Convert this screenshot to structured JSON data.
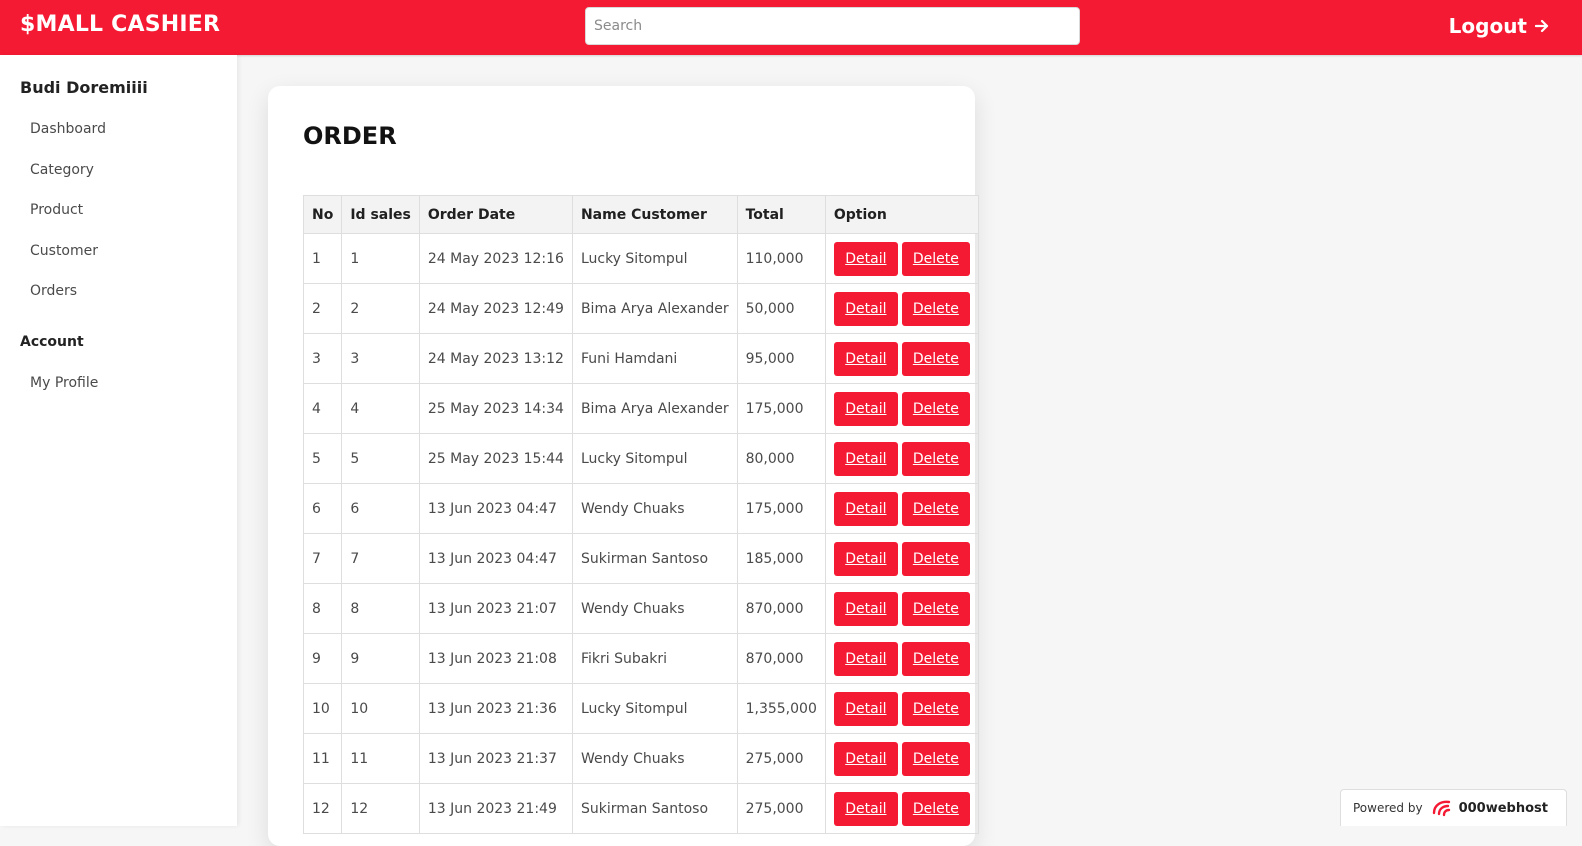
{
  "header": {
    "brand": "$MALL CASHIER",
    "search_placeholder": "Search",
    "logout_label": "Logout",
    "accent_color": "#f51a33"
  },
  "sidebar": {
    "user_name": "Budi Doremiiii",
    "items": [
      {
        "label": "Dashboard"
      },
      {
        "label": "Category"
      },
      {
        "label": "Product"
      },
      {
        "label": "Customer"
      },
      {
        "label": "Orders"
      }
    ],
    "account_title": "Account",
    "account_items": [
      {
        "label": "My Profile"
      }
    ]
  },
  "main": {
    "title": "ORDER",
    "columns": [
      "No",
      "Id sales",
      "Order Date",
      "Name Customer",
      "Total",
      "Option"
    ],
    "detail_label": "Detail",
    "delete_label": "Delete",
    "rows": [
      {
        "no": "1",
        "id": "1",
        "date": "24 May 2023 12:16",
        "customer": "Lucky Sitompul",
        "total": "110,000"
      },
      {
        "no": "2",
        "id": "2",
        "date": "24 May 2023 12:49",
        "customer": "Bima Arya Alexander",
        "total": "50,000"
      },
      {
        "no": "3",
        "id": "3",
        "date": "24 May 2023 13:12",
        "customer": "Funi Hamdani",
        "total": "95,000"
      },
      {
        "no": "4",
        "id": "4",
        "date": "25 May 2023 14:34",
        "customer": "Bima Arya Alexander",
        "total": "175,000"
      },
      {
        "no": "5",
        "id": "5",
        "date": "25 May 2023 15:44",
        "customer": "Lucky Sitompul",
        "total": "80,000"
      },
      {
        "no": "6",
        "id": "6",
        "date": "13 Jun 2023 04:47",
        "customer": "Wendy Chuaks",
        "total": "175,000"
      },
      {
        "no": "7",
        "id": "7",
        "date": "13 Jun 2023 04:47",
        "customer": "Sukirman Santoso",
        "total": "185,000"
      },
      {
        "no": "8",
        "id": "8",
        "date": "13 Jun 2023 21:07",
        "customer": "Wendy Chuaks",
        "total": "870,000"
      },
      {
        "no": "9",
        "id": "9",
        "date": "13 Jun 2023 21:08",
        "customer": "Fikri Subakri",
        "total": "870,000"
      },
      {
        "no": "10",
        "id": "10",
        "date": "13 Jun 2023 21:36",
        "customer": "Lucky Sitompul",
        "total": "1,355,000"
      },
      {
        "no": "11",
        "id": "11",
        "date": "13 Jun 2023 21:37",
        "customer": "Wendy Chuaks",
        "total": "275,000"
      },
      {
        "no": "12",
        "id": "12",
        "date": "13 Jun 2023 21:49",
        "customer": "Sukirman Santoso",
        "total": "275,000"
      }
    ]
  },
  "footer_badge": {
    "powered_by": "Powered by",
    "host": "000webhost"
  }
}
